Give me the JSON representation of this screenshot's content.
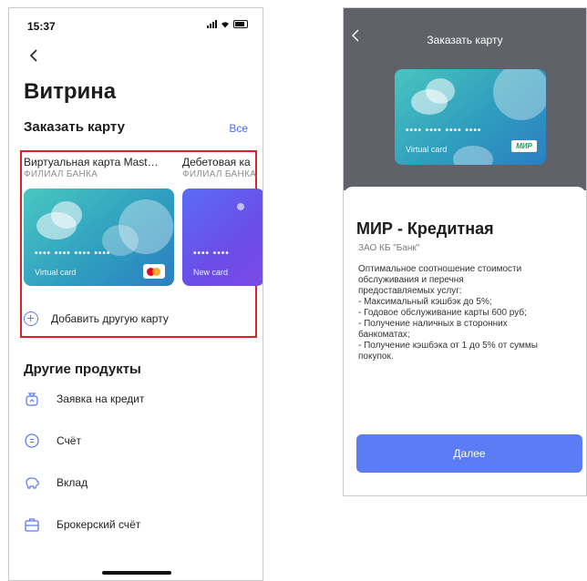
{
  "left_screen": {
    "status_time": "15:37",
    "title": "Витрина",
    "order_section": {
      "title": "Заказать карту",
      "all_link": "Все"
    },
    "cards": [
      {
        "name": "Виртуальная карта Mast…",
        "branch": "ФИЛИАЛ БАНКА",
        "card_label": "Virtual card",
        "dots": "•••• •••• •••• ••••"
      },
      {
        "name": "Дебетовая ка",
        "branch": "ФИЛИАЛ БАНКА",
        "card_label": "New card",
        "dots": "•••• ••••"
      }
    ],
    "add_card": "Добавить другую карту",
    "other_section": "Другие продукты",
    "products": [
      {
        "label": "Заявка на кредит",
        "icon": "loan-request-icon"
      },
      {
        "label": "Счёт",
        "icon": "account-icon"
      },
      {
        "label": "Вклад",
        "icon": "piggy-bank-icon"
      },
      {
        "label": "Брокерский счёт",
        "icon": "briefcase-icon"
      }
    ]
  },
  "right_screen": {
    "title": "Заказать карту",
    "card_label": "Virtual card",
    "card_dots": "•••• •••• •••• ••••",
    "badge": "МИР",
    "product_title": "МИР - Кредитная",
    "bank": "ЗАО КБ \"Банк\"",
    "description_lines": [
      "Оптимальное соотношение стоимости",
      "обслуживания и перечня",
      "предоставляемых услуг:",
      "- Максимальный кэшбэк до 5%;",
      "- Годовое обслуживание карты 600 руб;",
      "- Получение наличных в сторонних",
      "банкоматах;",
      "- Получение кэшбэка от 1 до 5% от суммы",
      "покупок."
    ],
    "button": "Далее"
  },
  "colors": {
    "accent": "#5b7cf5",
    "highlight": "#e21f26",
    "header_gray": "#5f6268"
  }
}
